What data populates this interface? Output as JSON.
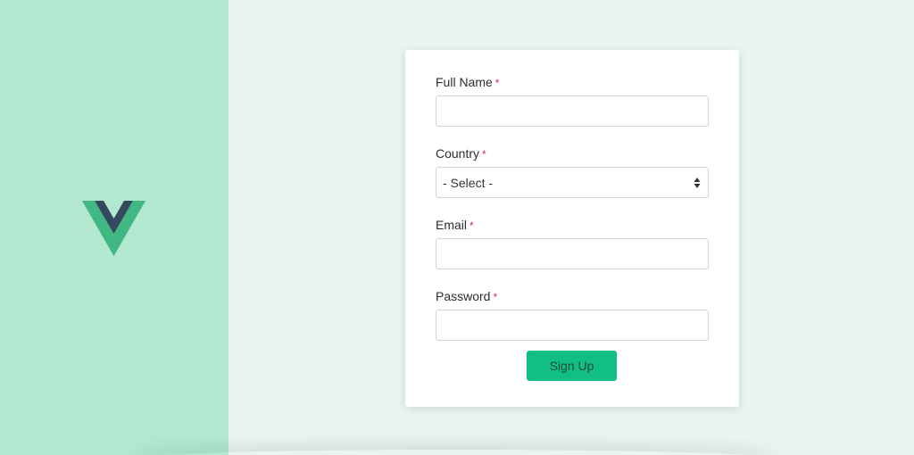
{
  "logo": {
    "icon": "vue-logo-icon",
    "colors": {
      "outer": "#41b883",
      "inner": "#34495e"
    }
  },
  "form": {
    "full_name": {
      "label": "Full Name",
      "required_mark": "*",
      "value": "",
      "placeholder": ""
    },
    "country": {
      "label": "Country",
      "required_mark": "*",
      "selected": "- Select -"
    },
    "email": {
      "label": "Email",
      "required_mark": "*",
      "value": "",
      "placeholder": ""
    },
    "password": {
      "label": "Password",
      "required_mark": "*",
      "value": "",
      "placeholder": ""
    },
    "submit_label": "Sign Up"
  },
  "colors": {
    "sidebar_bg": "#b2e8cf",
    "page_bg": "#e9f4f0",
    "button_bg": "#12bf83",
    "required_mark": "#e0245e"
  }
}
